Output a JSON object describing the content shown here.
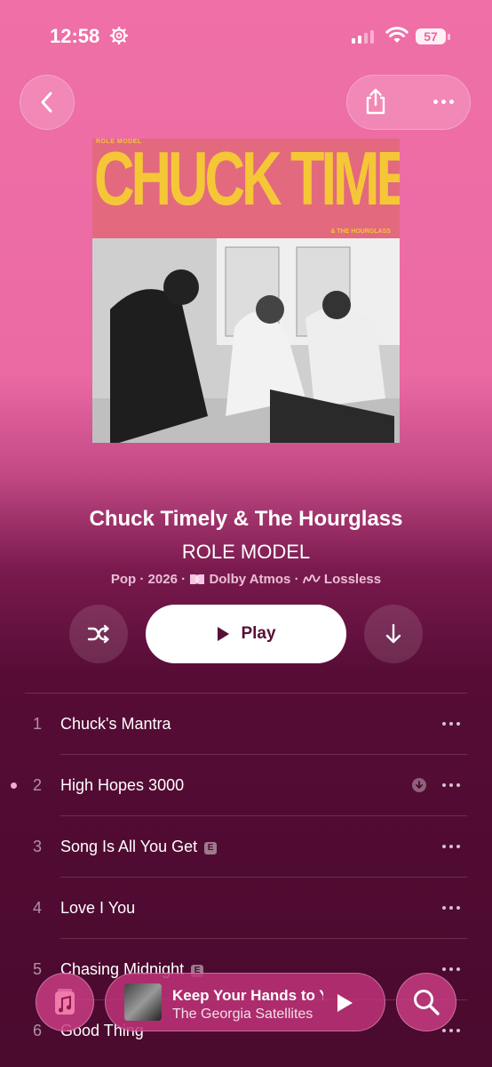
{
  "status_bar": {
    "time": "12:58",
    "battery": "57"
  },
  "nav": {
    "back_icon": "chevron-left-icon",
    "share_icon": "share-icon",
    "more_icon": "ellipsis-icon"
  },
  "cover": {
    "top_small": "ROLE MODEL",
    "big_title": "CHUCK TIMELY",
    "bottom_small": "& THE HOURGLASS"
  },
  "album": {
    "artist": "Chuck Timely & The Hourglass",
    "title": "ROLE MODEL",
    "genre": "Pop",
    "year": "2026",
    "dolby": "Dolby Atmos",
    "lossless": "Lossless"
  },
  "controls": {
    "play_label": "Play",
    "shuffle_icon": "shuffle-icon",
    "download_icon": "download-arrow-icon"
  },
  "tracks": [
    {
      "num": "1",
      "title": "Chuck's Mantra"
    },
    {
      "num": "2",
      "title": "High Hopes 3000"
    },
    {
      "num": "3",
      "title": "Song Is All You Get",
      "explicit": "E"
    },
    {
      "num": "4",
      "title": "Love I You"
    },
    {
      "num": "5",
      "title": "Chasing Midnight",
      "explicit": "E"
    },
    {
      "num": "6",
      "title": "Good Thing"
    }
  ],
  "mini_player": {
    "song": "Keep Your Hands to Yourself",
    "artist": "The Georgia Satellites"
  },
  "colors": {
    "accent": "#e9669f",
    "background_dark": "#4a0a2e"
  }
}
